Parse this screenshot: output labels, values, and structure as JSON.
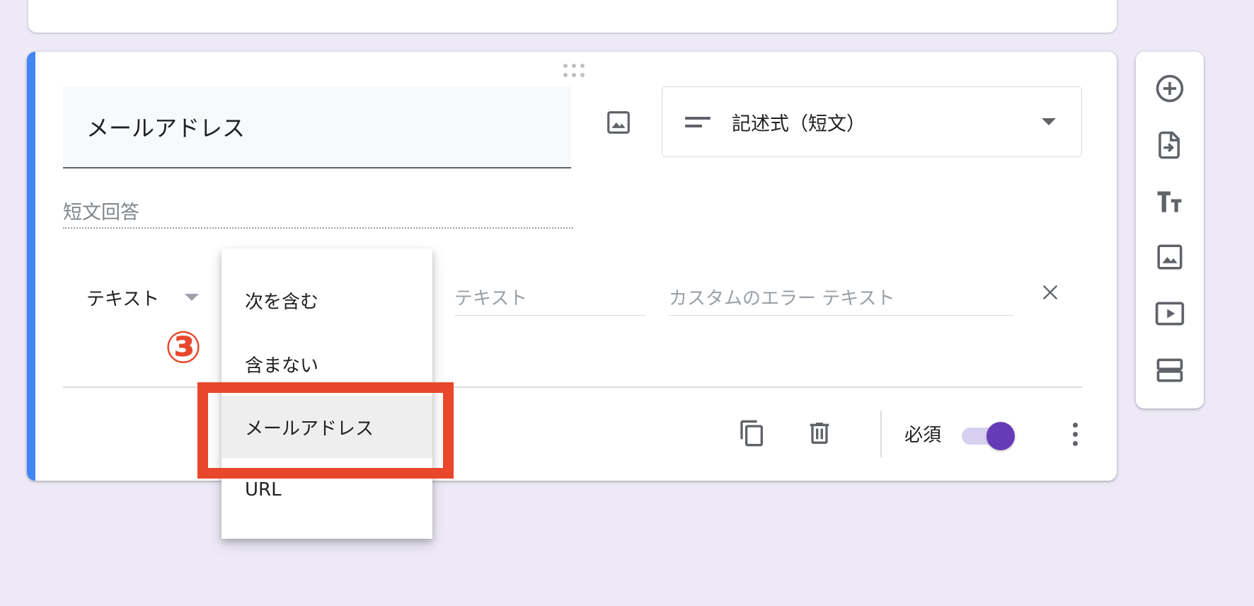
{
  "question": {
    "title": "メールアドレス",
    "type_label": "記述式（短文）",
    "answer_placeholder": "短文回答"
  },
  "validation": {
    "type_label": "テキスト",
    "text_placeholder": "テキスト",
    "error_placeholder": "カスタムのエラー テキスト",
    "options": [
      "次を含む",
      "含まない",
      "メールアドレス",
      "URL"
    ],
    "selected_option": "メールアドレス"
  },
  "footer": {
    "required_label": "必須",
    "required_on": true
  },
  "annotation": {
    "step_number": "③"
  },
  "colors": {
    "accent": "#4285f4",
    "toggle": "#673ab7",
    "highlight": "#e8472b",
    "background": "#ede9f7"
  },
  "sidebar_icons": [
    "add-question-icon",
    "import-questions-icon",
    "add-title-icon",
    "add-image-icon",
    "add-video-icon",
    "add-section-icon"
  ]
}
